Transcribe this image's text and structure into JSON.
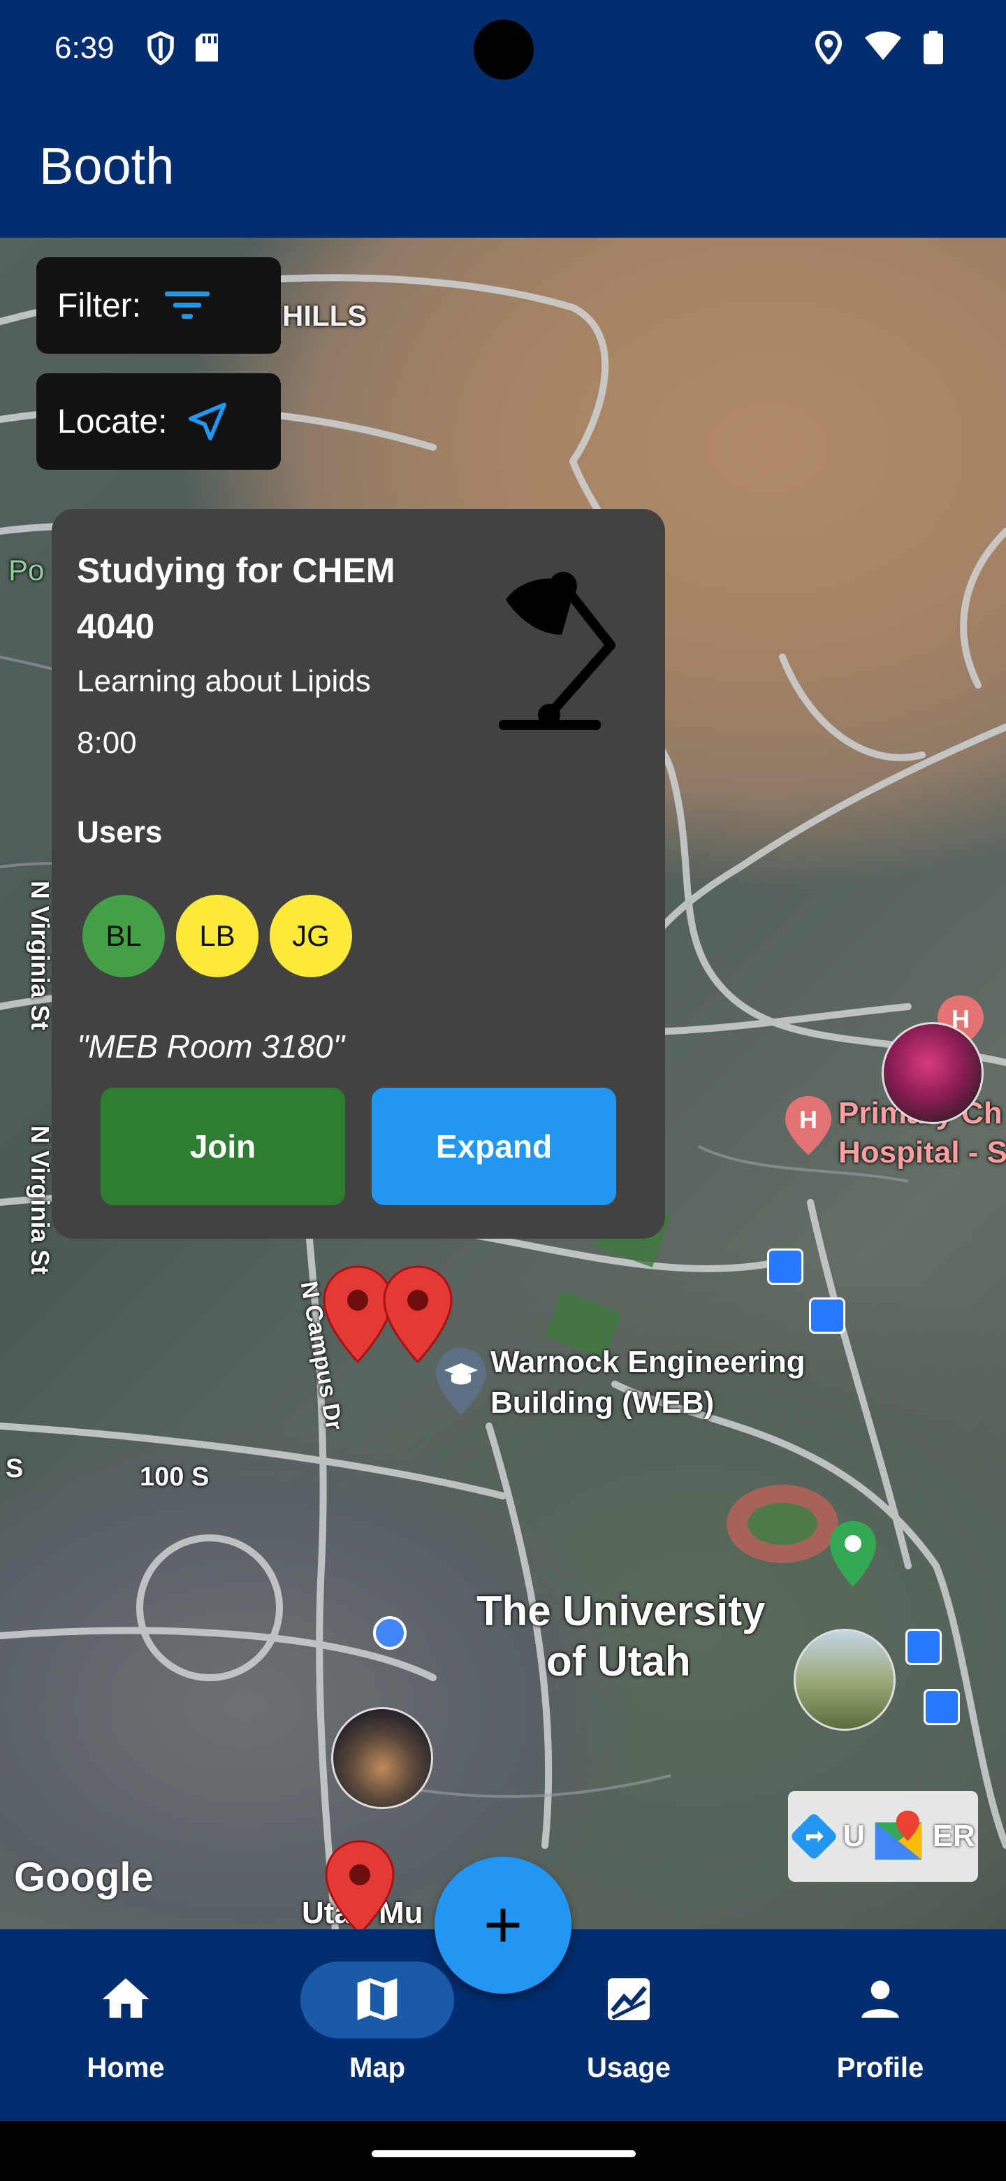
{
  "status_bar": {
    "time": "6:39",
    "icons_left": [
      "shield-icon",
      "sd-card-icon"
    ],
    "icons_right": [
      "location-icon",
      "wifi-icon",
      "battery-icon"
    ]
  },
  "app_bar": {
    "title": "Booth"
  },
  "map_controls": {
    "filter_label": "Filter:",
    "locate_label": "Locate:"
  },
  "map_labels": {
    "hills": "HILLS",
    "po": "Po",
    "n_virginia_1": "N Virginia St",
    "n_virginia_2": "N Virginia St",
    "n_campus": "N Campus Dr",
    "warnock": "Warnock Engineering",
    "warnock_2": "Building (WEB)",
    "s_100": "100 S",
    "s_only": "S",
    "uofu_1": "The University",
    "uofu_2": "of Utah",
    "primary_1": "Primary Ch",
    "primary_2": "Hospital - S",
    "utah_mu": "Utah Mu",
    "google": "Google",
    "maps_text": "U",
    "maps_text2": "ER"
  },
  "session_card": {
    "title": "Studying for CHEM 4040",
    "subtitle": "Learning about Lipids",
    "time": "8:00",
    "users_label": "Users",
    "users": [
      {
        "initials": "BL",
        "color": "#43a047"
      },
      {
        "initials": "LB",
        "color": "#fdea3a"
      },
      {
        "initials": "JG",
        "color": "#fdea3a"
      }
    ],
    "location": "\"MEB Room 3180\"",
    "join_label": "Join",
    "expand_label": "Expand",
    "icon": "desk-lamp-icon"
  },
  "fab": {
    "label": "+"
  },
  "bottom_nav": {
    "items": [
      {
        "label": "Home",
        "icon": "home-icon"
      },
      {
        "label": "Map",
        "icon": "map-icon",
        "active": true
      },
      {
        "label": "Usage",
        "icon": "chart-icon"
      },
      {
        "label": "Profile",
        "icon": "person-icon"
      }
    ]
  },
  "colors": {
    "primary": "#002d6e",
    "accent_blue": "#2196f3",
    "join_green": "#2e7d32",
    "card_bg": "#424242"
  }
}
